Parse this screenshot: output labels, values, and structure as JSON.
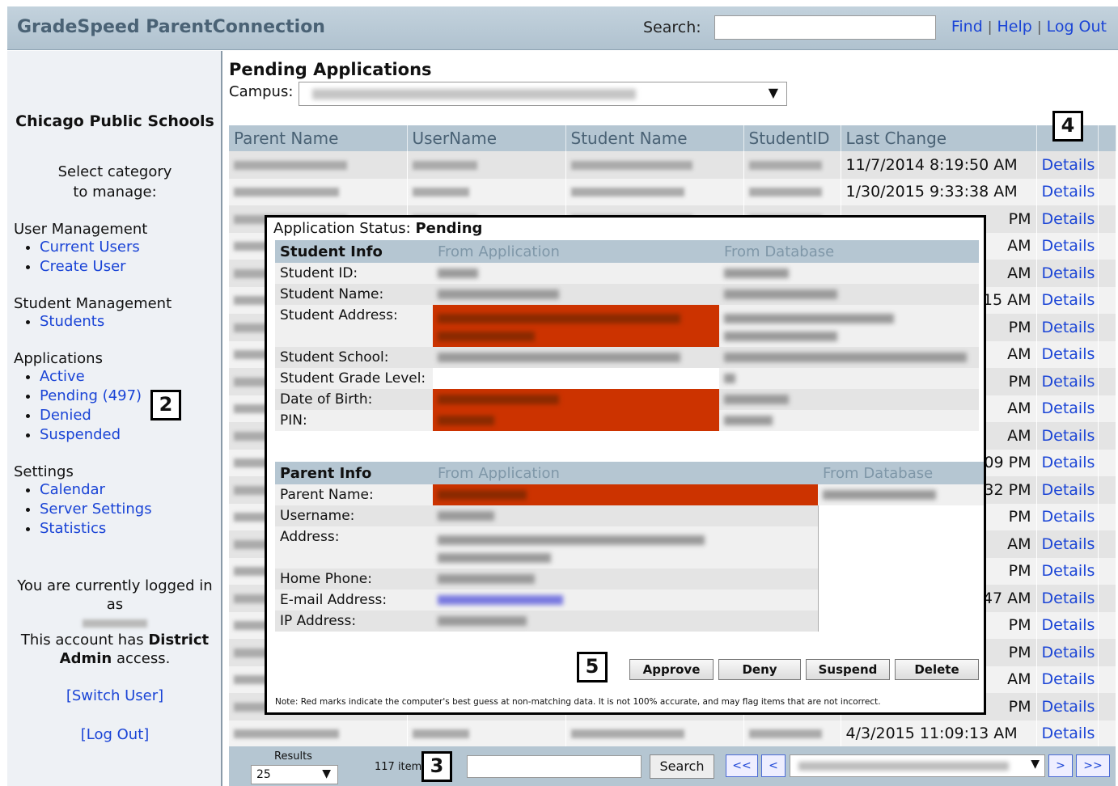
{
  "header": {
    "app_title": "GradeSpeed ParentConnection",
    "search_label": "Search:",
    "links": [
      "Find",
      "Help",
      "Log Out"
    ]
  },
  "sidebar": {
    "district": "Chicago Public Schools",
    "select_category": "Select category to manage:",
    "sections": [
      {
        "title": "User Management",
        "items": [
          "Current Users",
          "Create User"
        ]
      },
      {
        "title": "Student Management",
        "items": [
          "Students"
        ]
      },
      {
        "title": "Applications",
        "items": [
          "Active",
          "Pending (497)",
          "Denied",
          "Suspended"
        ]
      },
      {
        "title": "Settings",
        "items": [
          "Calendar",
          "Server Settings",
          "Statistics"
        ]
      }
    ],
    "logged_in_text": "You are currently logged in as",
    "access_text_prefix": "This account has",
    "access_level": "District Admin",
    "access_text_suffix": "access.",
    "switch_user": "[Switch User]",
    "log_out": "[Log Out]"
  },
  "markers": {
    "sidebar": "2",
    "pager": "3",
    "details": "4",
    "modal": "5"
  },
  "main": {
    "title": "Pending Applications",
    "campus_label": "Campus:",
    "columns": [
      "Parent Name",
      "UserName",
      "Student Name",
      "StudentID",
      "Last Change",
      ""
    ],
    "details_label": "Details",
    "last_change": [
      "11/7/2014 8:19:50 AM",
      "1/30/2015 9:33:38 AM",
      "PM",
      "AM",
      "AM",
      "15 AM",
      "PM",
      "AM",
      "PM",
      "AM",
      "AM",
      "09 PM",
      "32 PM",
      "PM",
      "AM",
      "PM",
      "47 AM",
      "PM",
      "PM",
      "AM",
      "PM",
      "4/3/2015 11:09:13 AM"
    ]
  },
  "pager": {
    "results_label": "Results",
    "results_value": "25",
    "items_text": "117 item",
    "search_button": "Search",
    "first": "<<",
    "prev": "<",
    "next": ">",
    "last": ">>"
  },
  "modal": {
    "status_label": "Application Status:",
    "status_value": "Pending",
    "student_headers": [
      "Student Info",
      "From Application",
      "From Database"
    ],
    "student_fields": [
      "Student ID:",
      "Student Name:",
      "Student Address:",
      "Student School:",
      "Student Grade Level:",
      "Date of Birth:",
      "PIN:"
    ],
    "parent_headers": [
      "Parent Info",
      "From Application",
      "From Database"
    ],
    "parent_fields": [
      "Parent Name:",
      "Username:",
      "Address:",
      "Home Phone:",
      "E-mail Address:",
      "IP Address:"
    ],
    "buttons": [
      "Approve",
      "Deny",
      "Suspend",
      "Delete"
    ],
    "note": "Note: Red marks indicate the computer's best guess at non-matching data.  It is not 100% accurate, and may flag items that are not incorrect."
  },
  "colors": {
    "header_bg": "#b5c6d2",
    "link": "#1a44d6",
    "mismatch": "#cc3300"
  }
}
